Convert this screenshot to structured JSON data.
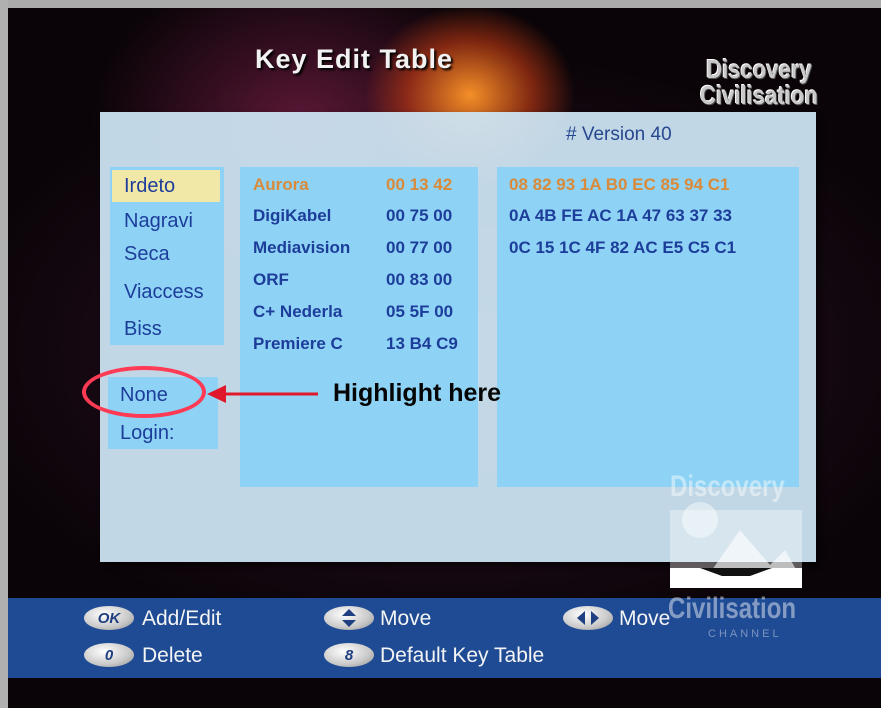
{
  "screen": {
    "title": "Key Edit Table",
    "logo_top": [
      "Discovery",
      "Civilisation"
    ],
    "version": "# Version 40"
  },
  "providers": [
    "Irdeto",
    "Nagravi",
    "Seca",
    "Viaccess",
    "Biss"
  ],
  "selected_provider": "Irdeto",
  "modes": [
    "None",
    "Login:"
  ],
  "entries": [
    {
      "name": "Aurora",
      "id": "00 13 42",
      "key": "08  82 93 1A B0 EC 85 94 C1",
      "highlighted": true
    },
    {
      "name": "DigiKabel",
      "id": "00 75 00",
      "key": "0A  4B FE AC 1A 47 63 37 33"
    },
    {
      "name": "Mediavision",
      "id": "00 77 00",
      "key": "0C  15 1C 4F 82 AC E5 C5 C1"
    },
    {
      "name": "ORF",
      "id": "00 83 00",
      "key": ""
    },
    {
      "name": "C+ Nederla",
      "id": "05 5F 00",
      "key": ""
    },
    {
      "name": "Premiere C",
      "id": "13 B4 C9",
      "key": ""
    }
  ],
  "annotation": {
    "text": "Highlight here"
  },
  "help": [
    {
      "key": "OK",
      "icon": "ok-button-icon",
      "label": "Add/Edit"
    },
    {
      "key": "",
      "icon": "up-down-arrows-icon",
      "label": "Move"
    },
    {
      "key": "",
      "icon": "left-right-arrows-icon",
      "label": "Move"
    },
    {
      "key": "0",
      "icon": "zero-button-icon",
      "label": "Delete"
    },
    {
      "key": "8",
      "icon": "eight-button-icon",
      "label": "Default Key Table"
    }
  ],
  "watermark": {
    "top": "Discovery",
    "bottom": "Civilisation",
    "sub": "CHANNEL"
  },
  "colors": {
    "annotation_ring": "#ff3a55",
    "selected_bg": "#f1e8a8",
    "highlight_text": "#d98a3a",
    "panel": "#8ed3f5",
    "bar": "#1f4b94"
  }
}
